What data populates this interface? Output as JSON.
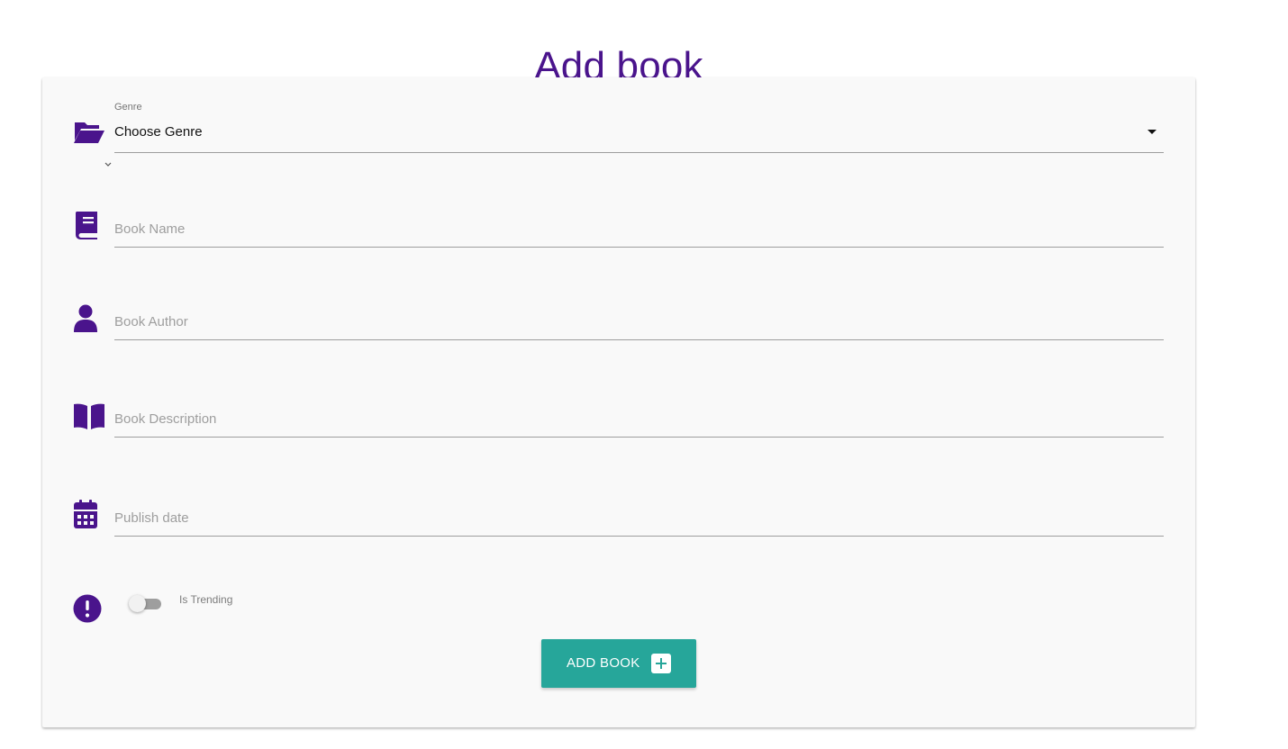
{
  "page": {
    "title": "Add book"
  },
  "form": {
    "genre": {
      "label": "Genre",
      "selected": "Choose Genre"
    },
    "book_name": {
      "placeholder": "Book Name",
      "value": ""
    },
    "book_author": {
      "placeholder": "Book Author",
      "value": ""
    },
    "book_description": {
      "placeholder": "Book Description",
      "value": ""
    },
    "publish_date": {
      "placeholder": "Publish date",
      "value": ""
    },
    "is_trending": {
      "label": "Is Trending",
      "checked": false
    },
    "submit_label": "ADD BOOK"
  },
  "icons": {
    "genre": "folder-open-icon",
    "book_name": "book-icon",
    "book_author": "user-icon",
    "book_description": "open-book-icon",
    "publish_date": "calendar-icon",
    "is_trending": "exclamation-circle-icon",
    "submit": "plus-square-icon"
  },
  "colors": {
    "accent": "#4a148c",
    "button": "#26a69a"
  }
}
